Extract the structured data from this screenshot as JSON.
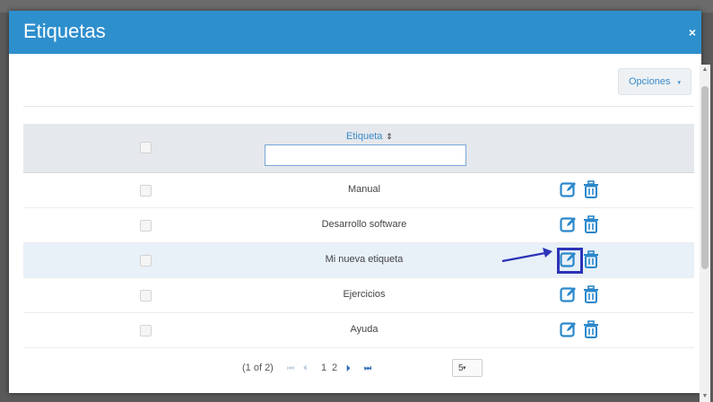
{
  "modal": {
    "title": "Etiquetas",
    "close_symbol": "×"
  },
  "toolbar": {
    "options_label": "Opciones",
    "options_caret": "▾"
  },
  "table": {
    "column_header": "Etiqueta",
    "sort_symbol": "⇕",
    "filter_value": "",
    "rows": [
      {
        "label": "Manual"
      },
      {
        "label": "Desarrollo software"
      },
      {
        "label": "Mi nueva etiqueta"
      },
      {
        "label": "Ejercicios"
      },
      {
        "label": "Ayuda"
      }
    ]
  },
  "pagination": {
    "report": "(1 of 2)",
    "first": "⏮",
    "prev": "⏴",
    "pages": [
      "1",
      "2"
    ],
    "next": "⏵",
    "last": "⏭",
    "rows_per_page": "5",
    "rows_caret": "▾"
  },
  "icons": {
    "edit": "edit-icon",
    "delete": "trash-icon",
    "close": "close-icon"
  },
  "colors": {
    "header": "#2e8fcd",
    "accent": "#3a8ac7",
    "highlight_row": "#e8f0f8",
    "annotation": "#2c33b8"
  }
}
